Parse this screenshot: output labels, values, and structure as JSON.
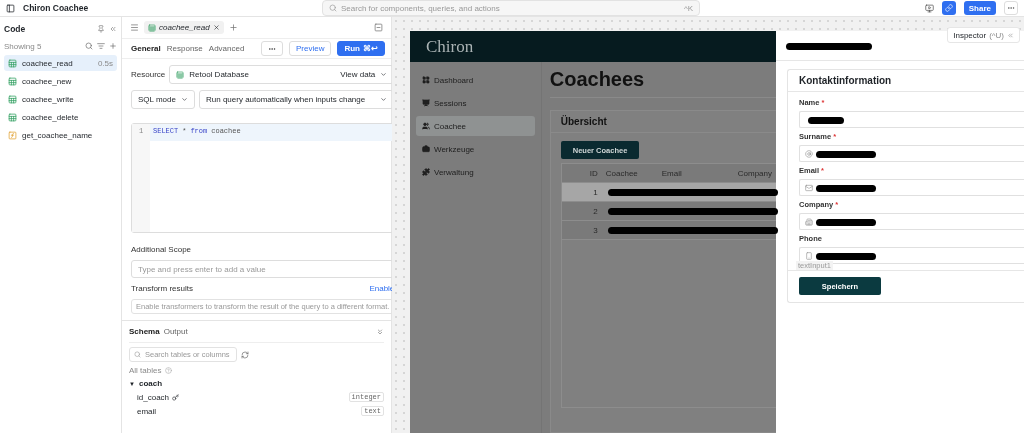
{
  "topbar": {
    "title": "Chiron Coachee",
    "search_placeholder": "Search for components, queries, and actions",
    "search_shortcut": "^K",
    "share": "Share"
  },
  "code_panel": {
    "title": "Code",
    "count": "Showing 5",
    "queries": [
      {
        "name": "coachee_read",
        "kind": "table",
        "duration": "0.5s",
        "selected": true
      },
      {
        "name": "coachee_new",
        "kind": "table",
        "selected": false
      },
      {
        "name": "coachee_write",
        "kind": "table",
        "selected": false
      },
      {
        "name": "coachee_delete",
        "kind": "table",
        "selected": false
      },
      {
        "name": "get_coachee_name",
        "kind": "function",
        "selected": false
      }
    ]
  },
  "editor": {
    "tabs": [
      {
        "label": "coachee_read",
        "selected": true
      }
    ],
    "subtabs": [
      {
        "label": "General",
        "selected": true
      },
      {
        "label": "Response",
        "selected": false
      },
      {
        "label": "Advanced",
        "selected": false
      }
    ],
    "preview": "Preview",
    "run": "Run",
    "run_shortcut": "⌘↩",
    "resource_label": "Resource",
    "resource": "Retool Database",
    "view_data": "View data",
    "mode": "SQL mode",
    "trigger": "Run query automatically when inputs change",
    "code": [
      {
        "line": "1",
        "tokens": [
          {
            "text": "SELECT",
            "kind": "keyword"
          },
          {
            "text": "*",
            "kind": "plain"
          },
          {
            "text": "from",
            "kind": "keyword"
          },
          {
            "text": "coachee",
            "kind": "plain"
          }
        ]
      }
    ],
    "scope_label": "Additional Scope",
    "scope_placeholder": "Type and press enter to add a value",
    "transform_label": "Transform results",
    "transform_action": "Enable",
    "transform_placeholder": "Enable transformers to transform the result of the query to a different format.",
    "bottom_tabs": [
      {
        "label": "Schema",
        "selected": true
      },
      {
        "label": "Output",
        "selected": false
      }
    ],
    "schema_search": "Search tables or columns",
    "all_tables": "All tables",
    "tables": [
      {
        "name": "coach",
        "toggle": "▼",
        "expanded": true,
        "columns": [
          {
            "name": "id_coach",
            "key": true,
            "type": "integer"
          },
          {
            "name": "email",
            "key": false,
            "type": "text"
          }
        ]
      }
    ]
  },
  "app": {
    "logo": "Chiron",
    "nav": [
      {
        "label": "Dashboard",
        "kind": "grid",
        "selected": false
      },
      {
        "label": "Sessions",
        "kind": "screen",
        "selected": false
      },
      {
        "label": "Coachee",
        "kind": "users",
        "selected": true
      },
      {
        "label": "Werkzeuge",
        "kind": "briefcase",
        "selected": false
      },
      {
        "label": "Verwaltung",
        "kind": "puzzle",
        "selected": false
      }
    ],
    "page_title": "Coachees",
    "card_title": "Übersicht",
    "new_button": "Neuer Coachee",
    "columns": [
      "ID",
      "Coachee",
      "Email",
      "Company"
    ],
    "rows": [
      {
        "id": "1",
        "selected": true
      },
      {
        "id": "2",
        "selected": false
      },
      {
        "id": "3",
        "selected": false
      }
    ]
  },
  "drawer": {
    "section_title": "Kontaktinformation",
    "fields": [
      {
        "label": "Name",
        "required": true,
        "kind": "plain"
      },
      {
        "label": "Surname",
        "required": true,
        "kind": "at"
      },
      {
        "label": "Email",
        "required": true,
        "kind": "mail"
      },
      {
        "label": "Company",
        "required": true,
        "kind": "building"
      },
      {
        "label": "Phone",
        "required": false,
        "kind": "phone"
      }
    ],
    "component_tag": "textInput1",
    "save": "Speichern"
  },
  "inspector": {
    "label": "Inspector",
    "shortcut": "(^U)"
  }
}
